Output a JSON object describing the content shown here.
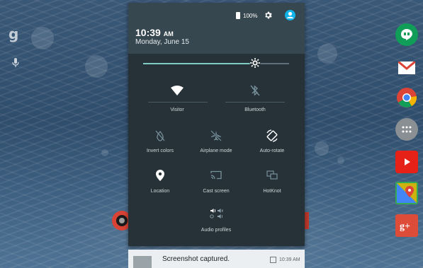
{
  "status": {
    "battery_icon": "battery-icon",
    "battery_percent": "100%",
    "settings_icon": "gear-icon",
    "account_icon": "account-icon"
  },
  "header": {
    "time": "10:39",
    "ampm": "AM",
    "date": "Monday, June 15"
  },
  "brightness": {
    "level": 0.76,
    "icon": "brightness-icon"
  },
  "tiles": [
    {
      "label": "Visitor",
      "icon": "wifi-icon",
      "active": true
    },
    {
      "label": "Bluetooth",
      "icon": "bluetooth-off-icon",
      "active": false
    },
    {
      "label": "Invert colors",
      "icon": "invert-colors-icon",
      "active": false
    },
    {
      "label": "Airplane mode",
      "icon": "airplane-icon",
      "active": false
    },
    {
      "label": "Auto-rotate",
      "icon": "auto-rotate-icon",
      "active": true
    },
    {
      "label": "Location",
      "icon": "location-pin-icon",
      "active": true
    },
    {
      "label": "Cast screen",
      "icon": "cast-icon",
      "active": false
    },
    {
      "label": "HotKnot",
      "icon": "hotknot-icon",
      "active": false
    },
    {
      "label": "Audio profiles",
      "icon": "audio-profiles-icon",
      "active": true
    }
  ],
  "notification": {
    "title": "Screenshot captured.",
    "time": "10:39 AM"
  },
  "home": {
    "search_icon": "google-search-icon",
    "google_glyph": "g",
    "mic_icon": "microphone-icon"
  },
  "dock": [
    {
      "name": "hangouts-icon",
      "color": "#0f9d58"
    },
    {
      "name": "gmail-icon",
      "color": "#db4437"
    },
    {
      "name": "chrome-icon",
      "color": "#4285f4"
    },
    {
      "name": "app-drawer-icon",
      "color": "#8a8f94"
    },
    {
      "name": "youtube-icon",
      "color": "#e62117"
    },
    {
      "name": "maps-icon",
      "color": "#34a853"
    },
    {
      "name": "google-plus-icon",
      "color": "#dd4b39"
    }
  ],
  "colors": {
    "shade_bg": "#263238",
    "header_bg": "#37474f",
    "accent": "#80cbc4",
    "avatar": "#10b4e8"
  }
}
